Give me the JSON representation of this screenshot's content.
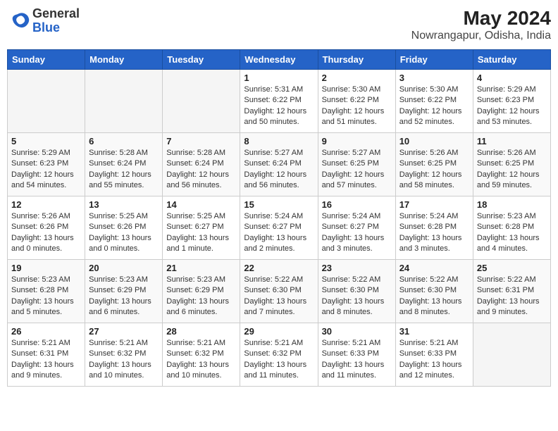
{
  "header": {
    "logo": {
      "general": "General",
      "blue": "Blue"
    },
    "month_year": "May 2024",
    "location": "Nowrangapur, Odisha, India"
  },
  "calendar": {
    "days_of_week": [
      "Sunday",
      "Monday",
      "Tuesday",
      "Wednesday",
      "Thursday",
      "Friday",
      "Saturday"
    ],
    "weeks": [
      [
        {
          "day": "",
          "info": ""
        },
        {
          "day": "",
          "info": ""
        },
        {
          "day": "",
          "info": ""
        },
        {
          "day": "1",
          "info": "Sunrise: 5:31 AM\nSunset: 6:22 PM\nDaylight: 12 hours\nand 50 minutes."
        },
        {
          "day": "2",
          "info": "Sunrise: 5:30 AM\nSunset: 6:22 PM\nDaylight: 12 hours\nand 51 minutes."
        },
        {
          "day": "3",
          "info": "Sunrise: 5:30 AM\nSunset: 6:22 PM\nDaylight: 12 hours\nand 52 minutes."
        },
        {
          "day": "4",
          "info": "Sunrise: 5:29 AM\nSunset: 6:23 PM\nDaylight: 12 hours\nand 53 minutes."
        }
      ],
      [
        {
          "day": "5",
          "info": "Sunrise: 5:29 AM\nSunset: 6:23 PM\nDaylight: 12 hours\nand 54 minutes."
        },
        {
          "day": "6",
          "info": "Sunrise: 5:28 AM\nSunset: 6:24 PM\nDaylight: 12 hours\nand 55 minutes."
        },
        {
          "day": "7",
          "info": "Sunrise: 5:28 AM\nSunset: 6:24 PM\nDaylight: 12 hours\nand 56 minutes."
        },
        {
          "day": "8",
          "info": "Sunrise: 5:27 AM\nSunset: 6:24 PM\nDaylight: 12 hours\nand 56 minutes."
        },
        {
          "day": "9",
          "info": "Sunrise: 5:27 AM\nSunset: 6:25 PM\nDaylight: 12 hours\nand 57 minutes."
        },
        {
          "day": "10",
          "info": "Sunrise: 5:26 AM\nSunset: 6:25 PM\nDaylight: 12 hours\nand 58 minutes."
        },
        {
          "day": "11",
          "info": "Sunrise: 5:26 AM\nSunset: 6:25 PM\nDaylight: 12 hours\nand 59 minutes."
        }
      ],
      [
        {
          "day": "12",
          "info": "Sunrise: 5:26 AM\nSunset: 6:26 PM\nDaylight: 13 hours\nand 0 minutes."
        },
        {
          "day": "13",
          "info": "Sunrise: 5:25 AM\nSunset: 6:26 PM\nDaylight: 13 hours\nand 0 minutes."
        },
        {
          "day": "14",
          "info": "Sunrise: 5:25 AM\nSunset: 6:27 PM\nDaylight: 13 hours\nand 1 minute."
        },
        {
          "day": "15",
          "info": "Sunrise: 5:24 AM\nSunset: 6:27 PM\nDaylight: 13 hours\nand 2 minutes."
        },
        {
          "day": "16",
          "info": "Sunrise: 5:24 AM\nSunset: 6:27 PM\nDaylight: 13 hours\nand 3 minutes."
        },
        {
          "day": "17",
          "info": "Sunrise: 5:24 AM\nSunset: 6:28 PM\nDaylight: 13 hours\nand 3 minutes."
        },
        {
          "day": "18",
          "info": "Sunrise: 5:23 AM\nSunset: 6:28 PM\nDaylight: 13 hours\nand 4 minutes."
        }
      ],
      [
        {
          "day": "19",
          "info": "Sunrise: 5:23 AM\nSunset: 6:28 PM\nDaylight: 13 hours\nand 5 minutes."
        },
        {
          "day": "20",
          "info": "Sunrise: 5:23 AM\nSunset: 6:29 PM\nDaylight: 13 hours\nand 6 minutes."
        },
        {
          "day": "21",
          "info": "Sunrise: 5:23 AM\nSunset: 6:29 PM\nDaylight: 13 hours\nand 6 minutes."
        },
        {
          "day": "22",
          "info": "Sunrise: 5:22 AM\nSunset: 6:30 PM\nDaylight: 13 hours\nand 7 minutes."
        },
        {
          "day": "23",
          "info": "Sunrise: 5:22 AM\nSunset: 6:30 PM\nDaylight: 13 hours\nand 8 minutes."
        },
        {
          "day": "24",
          "info": "Sunrise: 5:22 AM\nSunset: 6:30 PM\nDaylight: 13 hours\nand 8 minutes."
        },
        {
          "day": "25",
          "info": "Sunrise: 5:22 AM\nSunset: 6:31 PM\nDaylight: 13 hours\nand 9 minutes."
        }
      ],
      [
        {
          "day": "26",
          "info": "Sunrise: 5:21 AM\nSunset: 6:31 PM\nDaylight: 13 hours\nand 9 minutes."
        },
        {
          "day": "27",
          "info": "Sunrise: 5:21 AM\nSunset: 6:32 PM\nDaylight: 13 hours\nand 10 minutes."
        },
        {
          "day": "28",
          "info": "Sunrise: 5:21 AM\nSunset: 6:32 PM\nDaylight: 13 hours\nand 10 minutes."
        },
        {
          "day": "29",
          "info": "Sunrise: 5:21 AM\nSunset: 6:32 PM\nDaylight: 13 hours\nand 11 minutes."
        },
        {
          "day": "30",
          "info": "Sunrise: 5:21 AM\nSunset: 6:33 PM\nDaylight: 13 hours\nand 11 minutes."
        },
        {
          "day": "31",
          "info": "Sunrise: 5:21 AM\nSunset: 6:33 PM\nDaylight: 13 hours\nand 12 minutes."
        },
        {
          "day": "",
          "info": ""
        }
      ]
    ]
  }
}
